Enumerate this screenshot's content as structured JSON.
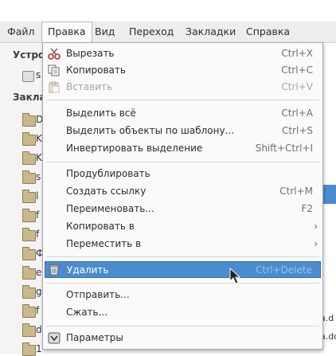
{
  "menubar": {
    "items": [
      {
        "label": "Файл"
      },
      {
        "label": "Правка"
      },
      {
        "label": "Вид"
      },
      {
        "label": "Переход"
      },
      {
        "label": "Закладки"
      },
      {
        "label": "Справка"
      }
    ]
  },
  "sidebar": {
    "devices_heading": "Устро",
    "bookmarks_heading": "Закла",
    "device_letter": "s",
    "folder_letters": [
      "D",
      "K",
      "K",
      "s",
      "l",
      "f",
      "f",
      "Ф",
      "e",
      "g",
      "f",
      "d",
      "1"
    ]
  },
  "right_fragments": [
    "a.d",
    "a.dc"
  ],
  "menu": {
    "items": [
      {
        "label": "Вырезать",
        "accel": "Ctrl+X",
        "icon": "scissors-icon"
      },
      {
        "label": "Копировать",
        "accel": "Ctrl+C",
        "icon": "copy-icon"
      },
      {
        "label": "Вставить",
        "accel": "Ctrl+V",
        "icon": "paste-icon"
      },
      {
        "label": "Выделить всё",
        "accel": "Ctrl+A"
      },
      {
        "label": "Выделить объекты по шаблону...",
        "accel": "Ctrl+S"
      },
      {
        "label": "Инвертировать выделение",
        "accel": "Shift+Ctrl+I"
      },
      {
        "label": "Продублировать",
        "accel": ""
      },
      {
        "label": "Создать ссылку",
        "accel": "Ctrl+M"
      },
      {
        "label": "Переименовать...",
        "accel": "F2"
      },
      {
        "label": "Копировать в",
        "accel": "",
        "submenu": true
      },
      {
        "label": "Переместить в",
        "accel": "",
        "submenu": true
      },
      {
        "label": "Удалить",
        "accel": "Ctrl+Delete",
        "icon": "trash-icon",
        "highlighted": true
      },
      {
        "label": "Отправить...",
        "accel": ""
      },
      {
        "label": "Сжать...",
        "accel": ""
      },
      {
        "label": "Параметры",
        "accel": "",
        "icon": "preferences-icon"
      }
    ]
  },
  "colors": {
    "highlight": "#4a8ccf",
    "menu_bg": "#fafafa",
    "menubar_bg": "#ededed"
  }
}
